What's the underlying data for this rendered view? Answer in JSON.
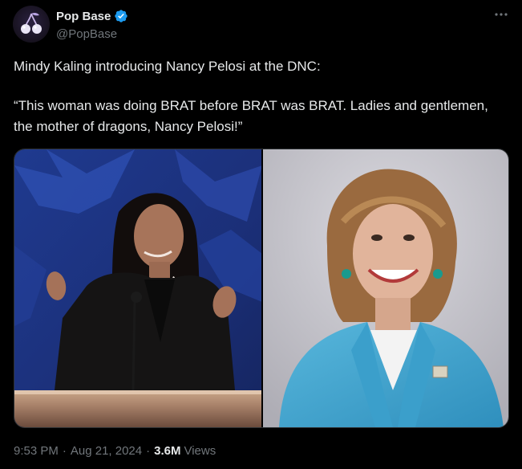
{
  "author": {
    "display_name": "Pop Base",
    "handle": "@PopBase",
    "verified_icon": "verified-badge-icon",
    "verified_color": "#1d9bf0",
    "avatar_icon": "cherry-logo-icon"
  },
  "more_icon": "more-horizontal-icon",
  "tweet": {
    "line1": "Mindy Kaling introducing Nancy Pelosi at the DNC:",
    "line2": "“This woman was doing BRAT before BRAT was BRAT. Ladies and gentlemen, the mother of dragons, Nancy Pelosi!”"
  },
  "media": [
    {
      "name": "photo-mindy-kaling-podium"
    },
    {
      "name": "photo-nancy-pelosi-portrait"
    }
  ],
  "meta": {
    "time": "9:53 PM",
    "separator": "·",
    "date": "Aug 21, 2024",
    "views_count": "3.6M",
    "views_label": "Views"
  },
  "colors": {
    "background": "#000000",
    "text_primary": "#e7e9ea",
    "text_secondary": "#71767b",
    "accent": "#1d9bf0"
  }
}
